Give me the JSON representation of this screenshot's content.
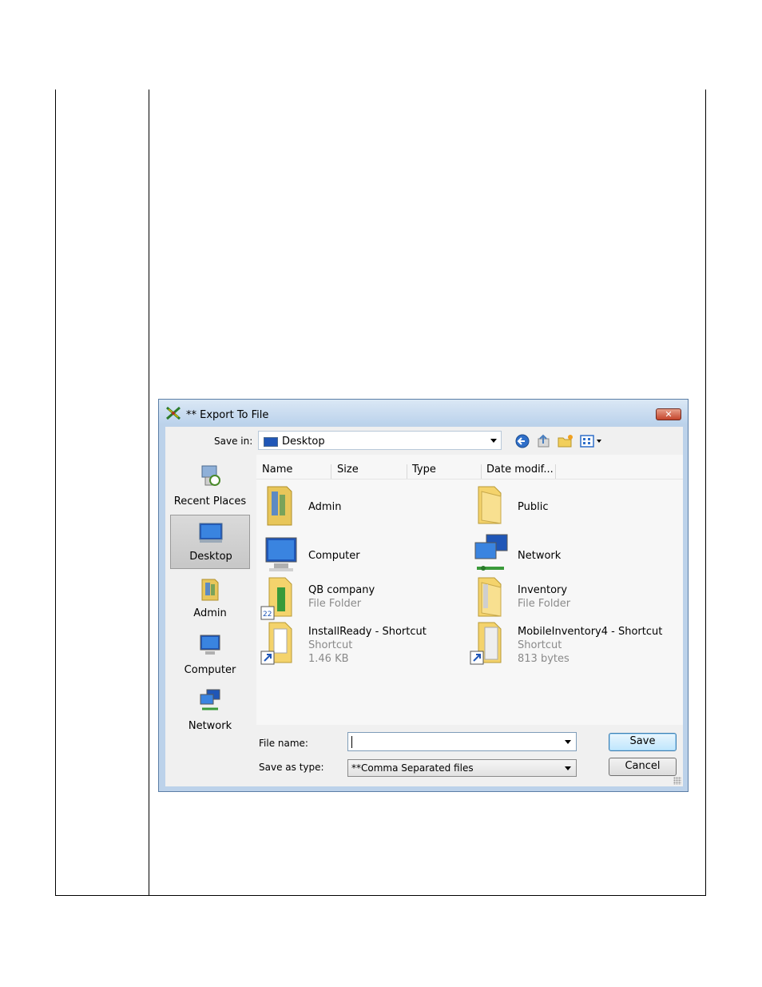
{
  "dialog": {
    "title": "** Export To File",
    "close_label": "✕"
  },
  "save_in": {
    "label": "Save in:",
    "value": "Desktop"
  },
  "toolbar_icons": [
    "back-icon",
    "up-folder-icon",
    "new-folder-icon",
    "views-menu-icon"
  ],
  "places": [
    {
      "label": "Recent Places",
      "icon": "recent-places-icon"
    },
    {
      "label": "Desktop",
      "icon": "desktop-icon",
      "selected": true
    },
    {
      "label": "Admin",
      "icon": "user-folder-icon"
    },
    {
      "label": "Computer",
      "icon": "computer-icon"
    },
    {
      "label": "Network",
      "icon": "network-icon"
    }
  ],
  "columns": [
    "Name",
    "Size",
    "Type",
    "Date modif..."
  ],
  "files": [
    {
      "name": "Admin",
      "icon": "user-folder-icon"
    },
    {
      "name": "Public",
      "icon": "folder-icon"
    },
    {
      "name": "Computer",
      "icon": "computer-icon"
    },
    {
      "name": "Network",
      "icon": "network-icon"
    },
    {
      "name": "QB company",
      "type": "File Folder",
      "icon": "qb-folder-icon"
    },
    {
      "name": "Inventory",
      "type": "File Folder",
      "icon": "folder-icon"
    },
    {
      "name": "InstallReady - Shortcut",
      "type": "Shortcut",
      "size": "1.46 KB",
      "icon": "shortcut-folder-icon"
    },
    {
      "name": "MobileInventory4 - Shortcut",
      "type": "Shortcut",
      "size": "813 bytes",
      "icon": "shortcut-folder-icon"
    }
  ],
  "file_name": {
    "label": "File name:",
    "value": ""
  },
  "save_as_type": {
    "label": "Save as type:",
    "value": "**Comma Separated files"
  },
  "buttons": {
    "save": "Save",
    "cancel": "Cancel"
  }
}
